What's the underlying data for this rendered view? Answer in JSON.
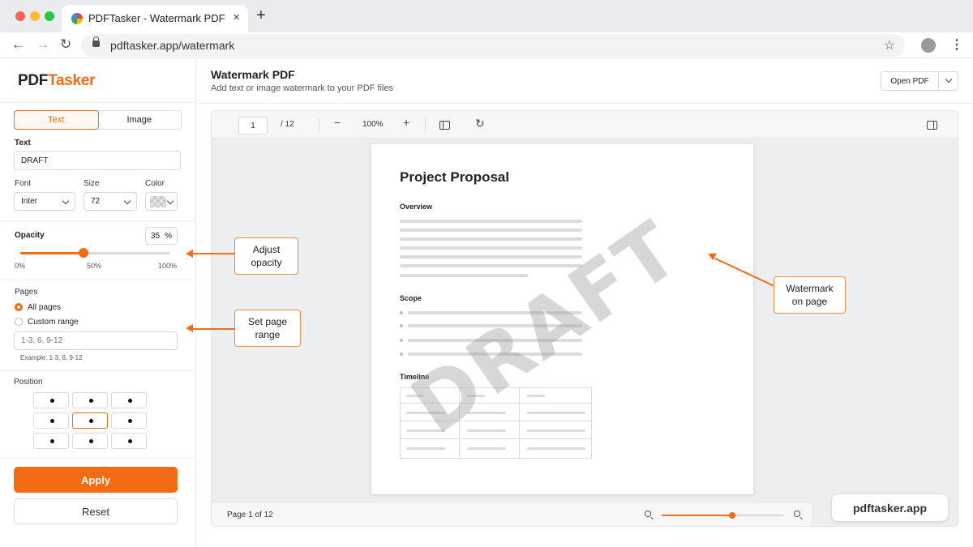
{
  "browser": {
    "tab_title": "PDFTasker - Watermark PDF",
    "tab_close": "×",
    "new_tab": "+",
    "url": "pdftasker.app/watermark",
    "back": "←",
    "forward": "→",
    "reload": "↻",
    "bookmark": "☆",
    "menu": "⋮"
  },
  "logo": {
    "part1": "PDF",
    "part2": "Tasker",
    "accent_color": "#f36b12"
  },
  "sidebar": {
    "mode_tabs": [
      "Text",
      "Image"
    ],
    "active_mode": "Text",
    "text_label": "Text",
    "text_value": "DRAFT",
    "font_label": "Font",
    "font_value": "Inter",
    "size_label": "Size",
    "size_value": "72",
    "color_label": "Color",
    "opacity_label": "Opacity",
    "opacity_value": "35",
    "opacity_unit": "%",
    "opacity_fraction": 0.42,
    "opacity_ticks": [
      "0%",
      "50%",
      "100%"
    ],
    "pages_label": "Pages",
    "pages_options": [
      "All pages",
      "Custom range"
    ],
    "pages_selected": "All pages",
    "range_placeholder": "1-3, 6, 9-12",
    "range_hint": "Example: 1-3, 6, 9-12",
    "position_label": "Position",
    "position_selected": "middle-center",
    "apply_label": "Apply",
    "reset_label": "Reset"
  },
  "header": {
    "title": "Watermark PDF",
    "subtitle": "Add text or image watermark to your PDF files",
    "open_pdf": "Open PDF"
  },
  "viewer": {
    "page_current": "1",
    "page_total": "/ 12",
    "zoom_out": "−",
    "zoom_level": "100%",
    "zoom_in": "+",
    "rotate": "↻",
    "footer_page_text": "Page 1 of 12",
    "zoom_fraction": 0.58
  },
  "document": {
    "title": "Project Proposal",
    "sections": [
      "Overview",
      "Scope",
      "Timeline"
    ],
    "watermark_text": "DRAFT"
  },
  "callouts": {
    "opacity": "Adjust\nopacity",
    "range": "Set page\nrange",
    "watermark": "Watermark\non page"
  },
  "site_badge": "pdftasker.app"
}
